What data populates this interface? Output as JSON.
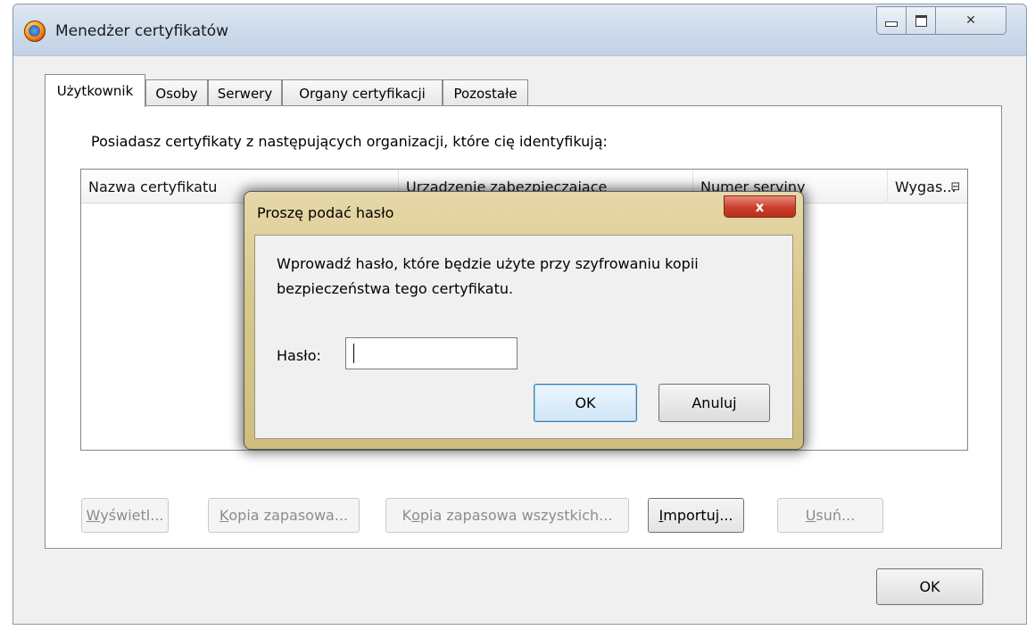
{
  "window": {
    "title": "Menedżer certyfikatów",
    "icon": "firefox-icon",
    "minimize_glyph": "minimize-icon",
    "maximize_glyph": "maximize-icon",
    "close_glyph": "✕"
  },
  "tabs": [
    {
      "label": "Użytkownik",
      "active": true
    },
    {
      "label": "Osoby",
      "active": false
    },
    {
      "label": "Serwery",
      "active": false
    },
    {
      "label": "Organy certyfikacji",
      "active": false
    },
    {
      "label": "Pozostałe",
      "active": false
    }
  ],
  "panel": {
    "description": "Posiadasz certyfikaty z następujących organizacji, które cię identyfikują:",
    "columns": [
      "Nazwa certyfikatu",
      "Urządzenie zabezpieczające",
      "Numer seryjny",
      "Wygas..."
    ],
    "column_picker_icon": "column-picker-icon",
    "buttons": {
      "view": {
        "accel": "W",
        "rest": "yświetl..."
      },
      "backup": {
        "accel": "K",
        "rest": "opia zapasowa..."
      },
      "backup_all_pre": "K",
      "backup_all_accel": "o",
      "backup_all_rest": "pia zapasowa wszystkich...",
      "import": {
        "accel": "I",
        "rest": "mportuj..."
      },
      "delete": {
        "accel": "U",
        "rest": "suń..."
      }
    }
  },
  "main_ok_label": "OK",
  "modal": {
    "title": "Proszę podać hasło",
    "close_glyph": "x",
    "message_line1": "Wprowadź hasło, które będzie użyte przy szyfrowaniu kopii",
    "message_line2": "bezpieczeństwa tego certyfikatu.",
    "password_label": "Hasło:",
    "password_value": "",
    "ok_label": "OK",
    "cancel_label": "Anuluj"
  },
  "colors": {
    "modal_frame": "#d9c88d",
    "close_red": "#c9402c",
    "default_button_border": "#3c7fb1"
  }
}
